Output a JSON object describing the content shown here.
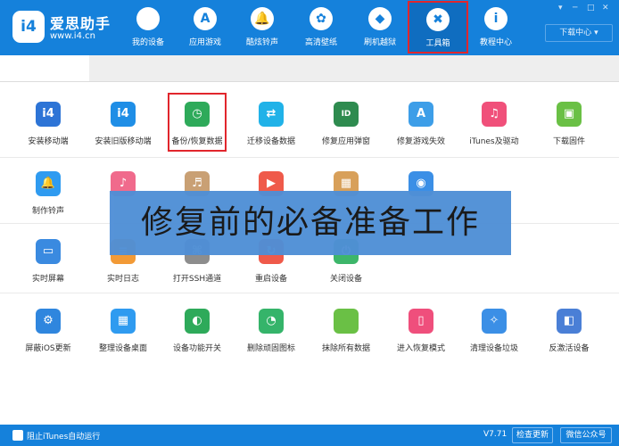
{
  "header": {
    "logo_text": "i4",
    "brand_name": "爱思助手",
    "brand_url": "www.i4.cn",
    "nav": [
      {
        "label": "我的设备",
        "icon": "apple-icon",
        "glyph": ""
      },
      {
        "label": "应用游戏",
        "icon": "app-store-icon",
        "glyph": "A"
      },
      {
        "label": "酷炫铃声",
        "icon": "bell-icon",
        "glyph": "🔔"
      },
      {
        "label": "高清壁纸",
        "icon": "flower-icon",
        "glyph": "✿"
      },
      {
        "label": "刷机越狱",
        "icon": "dropbox-icon",
        "glyph": "◆"
      },
      {
        "label": "工具箱",
        "icon": "tools-icon",
        "glyph": "✖"
      },
      {
        "label": "教程中心",
        "icon": "info-icon",
        "glyph": "i"
      }
    ],
    "download_center": "下载中心 ▾",
    "window_controls": [
      "▾",
      "─",
      "□",
      "✕"
    ]
  },
  "tools": [
    {
      "label": "安装移动端",
      "icon": "i4-icon",
      "glyph": "i4",
      "color": "#2d74d6"
    },
    {
      "label": "安装旧版移动端",
      "icon": "i4-icon",
      "glyph": "i4",
      "color": "#1f8ee6"
    },
    {
      "label": "备份/恢复数据",
      "icon": "backup-clock-icon",
      "glyph": "◷",
      "color": "#2eaa5a"
    },
    {
      "label": "迁移设备数据",
      "icon": "transfer-icon",
      "glyph": "⇄",
      "color": "#20b2e8"
    },
    {
      "label": "修复应用弹窗",
      "icon": "apple-id-icon",
      "glyph": "ID",
      "color": "#2e8b4f"
    },
    {
      "label": "修复游戏失效",
      "icon": "app-store-icon",
      "glyph": "A",
      "color": "#3d9ee8"
    },
    {
      "label": "iTunes及驱动",
      "icon": "itunes-icon",
      "glyph": "♫",
      "color": "#f0507a"
    },
    {
      "label": "下载固件",
      "icon": "cube-icon",
      "glyph": "▣",
      "color": "#6ac045"
    },
    {
      "label": "制作铃声",
      "icon": "bell-icon",
      "glyph": "🔔",
      "color": "#2f9bf0"
    },
    {
      "label": "",
      "icon": "music-icon",
      "glyph": "♪",
      "color": "#f06a8c"
    },
    {
      "label": "",
      "icon": "music-convert-icon",
      "glyph": "♬",
      "color": "#c9a074"
    },
    {
      "label": "",
      "icon": "video-icon",
      "glyph": "▶",
      "color": "#ef5a4a"
    },
    {
      "label": "",
      "icon": "image-icon",
      "glyph": "▦",
      "color": "#d8a05a"
    },
    {
      "label": "",
      "icon": "photo-icon",
      "glyph": "◉",
      "color": "#3b8fe6"
    },
    {
      "label": "实时屏幕",
      "icon": "monitor-icon",
      "glyph": "▭",
      "color": "#3a8ae0"
    },
    {
      "label": "实时日志",
      "icon": "log-icon",
      "glyph": "≡",
      "color": "#f29a36"
    },
    {
      "label": "打开SSH通道",
      "icon": "ssh-icon",
      "glyph": "⌘",
      "color": "#8d8d8d"
    },
    {
      "label": "重启设备",
      "icon": "restart-icon",
      "glyph": "↻",
      "color": "#ef5a4a"
    },
    {
      "label": "关闭设备",
      "icon": "power-icon",
      "glyph": "⏻",
      "color": "#3db66a"
    },
    {
      "label": "屏蔽iOS更新",
      "icon": "gear-icon",
      "glyph": "⚙",
      "color": "#2f86de"
    },
    {
      "label": "整理设备桌面",
      "icon": "grid-icon",
      "glyph": "▦",
      "color": "#2f9bf0"
    },
    {
      "label": "设备功能开关",
      "icon": "toggle-icon",
      "glyph": "◐",
      "color": "#2eaa5a"
    },
    {
      "label": "删除顽固图标",
      "icon": "pie-chart-icon",
      "glyph": "◔",
      "color": "#35b46a"
    },
    {
      "label": "抹除所有数据",
      "icon": "apple-icon",
      "glyph": "",
      "color": "#6ac045"
    },
    {
      "label": "进入恢复模式",
      "icon": "phone-icon",
      "glyph": "▯",
      "color": "#ef4f7c"
    },
    {
      "label": "清理设备垃圾",
      "icon": "broom-icon",
      "glyph": "✧",
      "color": "#3b8fe6"
    },
    {
      "label": "反激活设备",
      "icon": "deactivate-icon",
      "glyph": "◧",
      "color": "#4a7fd6"
    }
  ],
  "overlay": {
    "text": "修复前的必备准备工作"
  },
  "footer": {
    "itunes_option": "阻止iTunes自动运行",
    "version": "V7.71",
    "check_update": "检查更新",
    "wechat": "微信公众号"
  }
}
